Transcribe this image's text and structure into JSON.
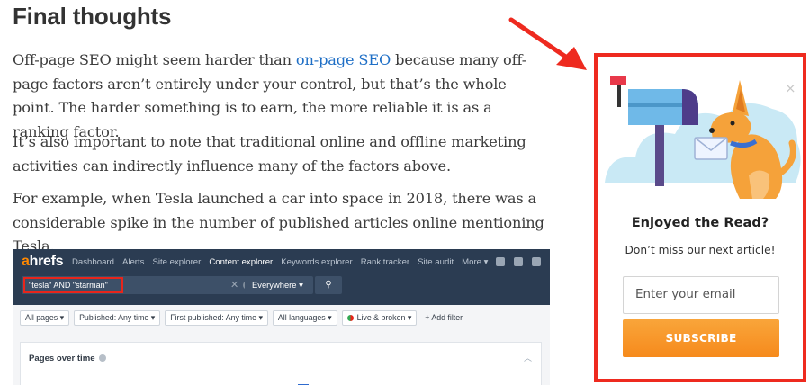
{
  "article": {
    "heading": "Final thoughts",
    "p1_before": "Off-page SEO might seem harder than ",
    "p1_link": "on-page SEO",
    "p1_after": " because many off-page factors aren’t entirely under your control, but that’s the whole point. The harder something is to earn, the more reliable it is as a ranking factor.",
    "p2": "It’s also important to note that traditional online and offline marketing activities can indirectly influence many of the factors above.",
    "p3": "For example, when Tesla launched a car into space in 2018, there was a considerable spike in the number of published articles online mentioning Tesla."
  },
  "screenshot": {
    "logo_a": "a",
    "logo_rest": "hrefs",
    "nav": [
      "Dashboard",
      "Alerts",
      "Site explorer",
      "Content explorer",
      "Keywords explorer",
      "Rank tracker",
      "Site audit",
      "More ▾"
    ],
    "active_nav": "Content explorer",
    "query": "\"tesla\" AND \"starman\"",
    "scope": "Everywhere ▾",
    "filters": [
      "All pages ▾",
      "Published: Any time ▾",
      "First published: Any time ▾",
      "All languages ▾",
      "Live & broken ▾"
    ],
    "add_filter": "+ Add filter",
    "panel_title": "Pages over time"
  },
  "popup": {
    "close": "×",
    "title": "Enjoyed the Read?",
    "subtitle": "Don’t miss our next article!",
    "email_placeholder": "Enter your email",
    "button": "SUBSCRIBE"
  },
  "colors": {
    "highlight_red": "#ee2a1f",
    "subscribe_orange": "#f7931e",
    "link_blue": "#1f6fc6",
    "ahrefs_navy": "#2b3c52"
  }
}
